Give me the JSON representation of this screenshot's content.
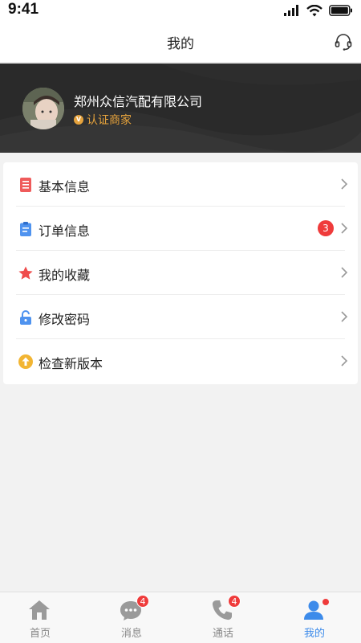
{
  "status_bar": {
    "time": "9:41"
  },
  "nav": {
    "title": "我的",
    "support_icon": "headset-icon"
  },
  "profile": {
    "company_name": "郑州众信汽配有限公司",
    "cert_mark": "V",
    "cert_label": "认证商家",
    "cert_color": "#e6a33d"
  },
  "menu": {
    "items": [
      {
        "label": "基本信息",
        "icon": "document-icon",
        "color": "#ef5b5b"
      },
      {
        "label": "订单信息",
        "icon": "clipboard-icon",
        "color": "#4f93ef",
        "badge": "3"
      },
      {
        "label": "我的收藏",
        "icon": "star-icon",
        "color": "#ef4b4b"
      },
      {
        "label": "修改密码",
        "icon": "lock-icon",
        "color": "#4f93ef"
      },
      {
        "label": "检查新版本",
        "icon": "upgrade-icon",
        "color": "#f2b533"
      }
    ]
  },
  "tabs": [
    {
      "label": "首页",
      "icon": "home-icon"
    },
    {
      "label": "消息",
      "icon": "chat-icon",
      "badge": "4"
    },
    {
      "label": "通话",
      "icon": "phone-icon",
      "badge": "4"
    },
    {
      "label": "我的",
      "icon": "user-icon",
      "active": true
    }
  ],
  "colors": {
    "accent": "#3d8bea",
    "badge": "#ef3b3b",
    "banner": "#2a2a2a"
  }
}
